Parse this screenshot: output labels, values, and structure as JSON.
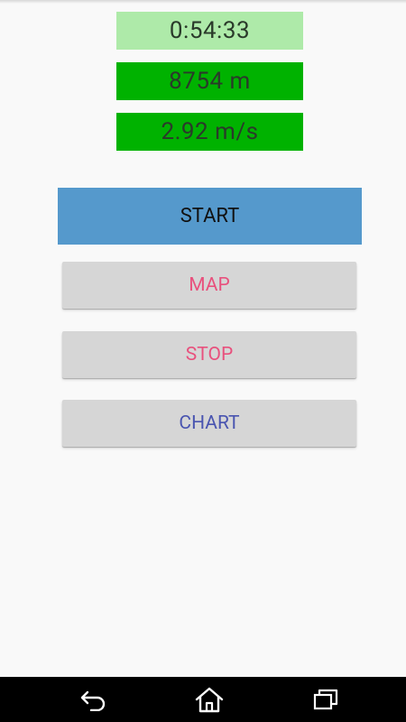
{
  "stats": {
    "elapsed_time": "0:54:33",
    "distance": "8754 m",
    "speed": "2.92 m/s"
  },
  "buttons": {
    "start": "START",
    "map": "MAP",
    "stop": "STOP",
    "chart": "CHART"
  },
  "colors": {
    "time_bg": "#aeeaa9",
    "distance_bg": "#00b200",
    "speed_bg": "#00b200",
    "start_bg": "#5599cc",
    "map_text": "#e8517d",
    "stop_text": "#e8517d",
    "chart_text": "#4a55b0"
  },
  "navbar": {
    "icons": [
      "back-icon",
      "home-icon",
      "recent-apps-icon"
    ]
  }
}
